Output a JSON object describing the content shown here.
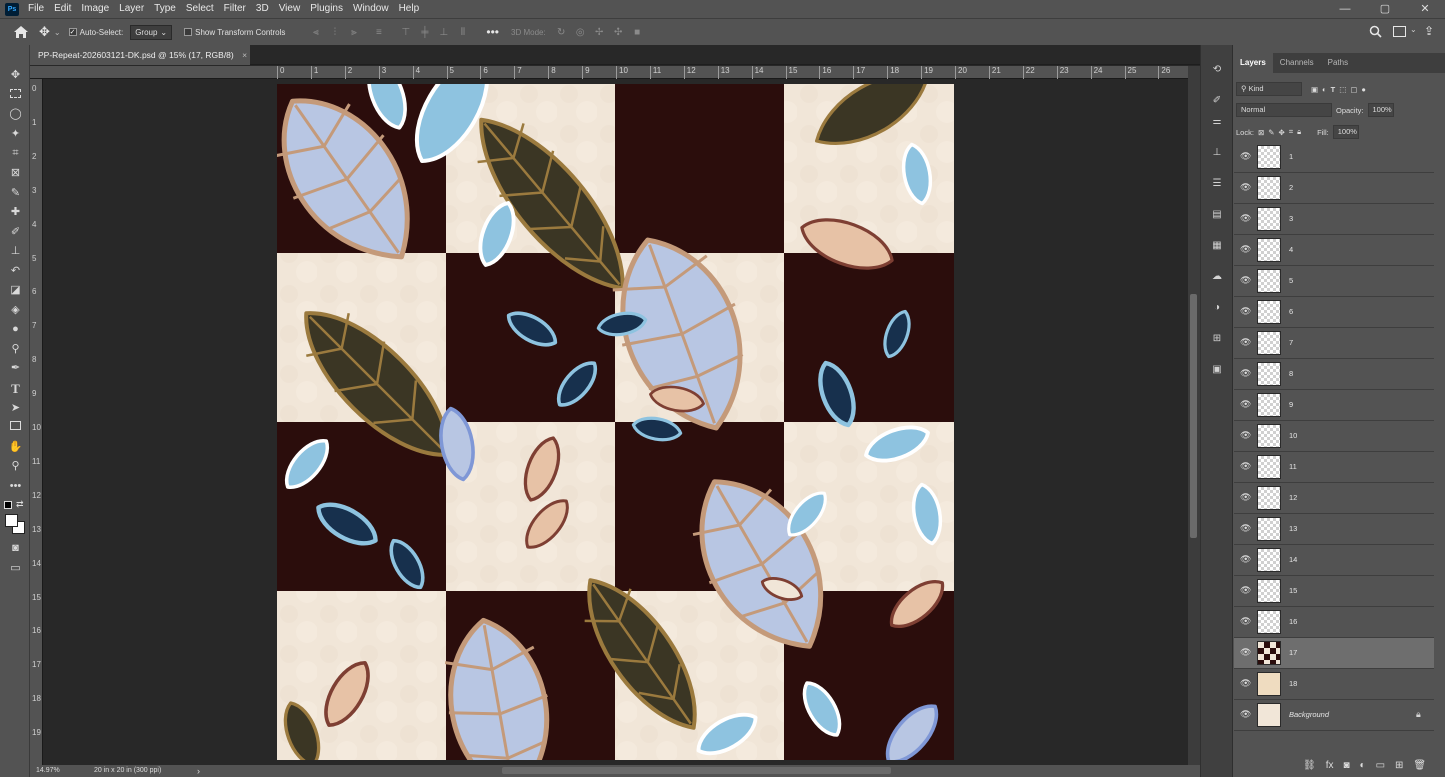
{
  "app": {
    "logo": "Ps"
  },
  "menu": [
    "File",
    "Edit",
    "Image",
    "Layer",
    "Type",
    "Select",
    "Filter",
    "3D",
    "View",
    "Plugins",
    "Window",
    "Help"
  ],
  "window_controls": [
    "—",
    "▢",
    "✕"
  ],
  "options": {
    "auto_select_label": "Auto-Select:",
    "auto_select_value": "Group",
    "show_transform_label": "Show Transform Controls",
    "mode_3d_label": "3D Mode:"
  },
  "document": {
    "tab_title": "PP-Repeat-202603121-DK.psd @ 15% (17, RGB/8)",
    "close": "×"
  },
  "ruler": {
    "top_ticks": [
      "0",
      "1",
      "2",
      "3",
      "4",
      "5",
      "6",
      "7",
      "8",
      "9",
      "10",
      "11",
      "12",
      "13",
      "14",
      "15",
      "16",
      "17",
      "18",
      "19",
      "20",
      "21",
      "22",
      "23",
      "24",
      "25",
      "26"
    ],
    "left_ticks": [
      "0",
      "1",
      "2",
      "3",
      "4",
      "5",
      "6",
      "7",
      "8",
      "9",
      "10",
      "11",
      "12",
      "13",
      "14",
      "15",
      "16",
      "17",
      "18",
      "19"
    ]
  },
  "status": {
    "zoom": "14.97%",
    "doc_info": "20 in x 20 in (300 ppi)",
    "arrow": "›"
  },
  "layers_panel": {
    "tabs": [
      "Layers",
      "Channels",
      "Paths"
    ],
    "filter_kind": "Kind",
    "blend_mode": "Normal",
    "opacity_label": "Opacity:",
    "opacity_value": "100%",
    "lock_label": "Lock:",
    "fill_label": "Fill:",
    "fill_value": "100%",
    "layers": [
      {
        "name": "1"
      },
      {
        "name": "2"
      },
      {
        "name": "3"
      },
      {
        "name": "4"
      },
      {
        "name": "5"
      },
      {
        "name": "6"
      },
      {
        "name": "7"
      },
      {
        "name": "8"
      },
      {
        "name": "9"
      },
      {
        "name": "10"
      },
      {
        "name": "11"
      },
      {
        "name": "12"
      },
      {
        "name": "13"
      },
      {
        "name": "14"
      },
      {
        "name": "15"
      },
      {
        "name": "16"
      },
      {
        "name": "17"
      },
      {
        "name": "18"
      },
      {
        "name": "Background"
      }
    ],
    "selected_layer": "17"
  },
  "colors": {
    "chrome": "#535353",
    "canvas_bg": "#282828",
    "art_cream": "#f1e6d8",
    "art_dark": "#2b0d0c",
    "leaf_blue": "#8ec3e0",
    "leaf_lavender": "#b8c6e3",
    "leaf_navy": "#17304d",
    "leaf_olive": "#3b3624",
    "leaf_peach": "#e7c2a6"
  }
}
